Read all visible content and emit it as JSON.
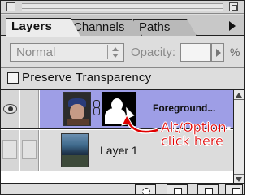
{
  "tabs": [
    {
      "label": "Layers",
      "active": true
    },
    {
      "label": "Channels",
      "active": false
    },
    {
      "label": "Paths",
      "active": false
    }
  ],
  "blend_mode": {
    "value": "Normal"
  },
  "opacity": {
    "label": "Opacity:",
    "value": "",
    "unit": "%"
  },
  "preserve_transparency": {
    "label": "Preserve Transparency",
    "checked": false
  },
  "layers": [
    {
      "name": "Foreground...",
      "selected": true,
      "visible": true,
      "has_mask": true
    },
    {
      "name": "Layer 1",
      "selected": false,
      "visible": false,
      "has_mask": false
    }
  ],
  "annotation": {
    "text": "Alt/Option-click here",
    "color": "#e00000"
  },
  "colors": {
    "selection": "#9e9ee6",
    "panel": "#dddddd",
    "annotation": "#e00000"
  },
  "icons": {
    "visibility": "eye-icon",
    "edit": "brush-icon",
    "link": "chain-icon",
    "new_mask": "layer-mask-icon",
    "new_layer": "new-layer-icon",
    "delete": "trash-icon"
  }
}
